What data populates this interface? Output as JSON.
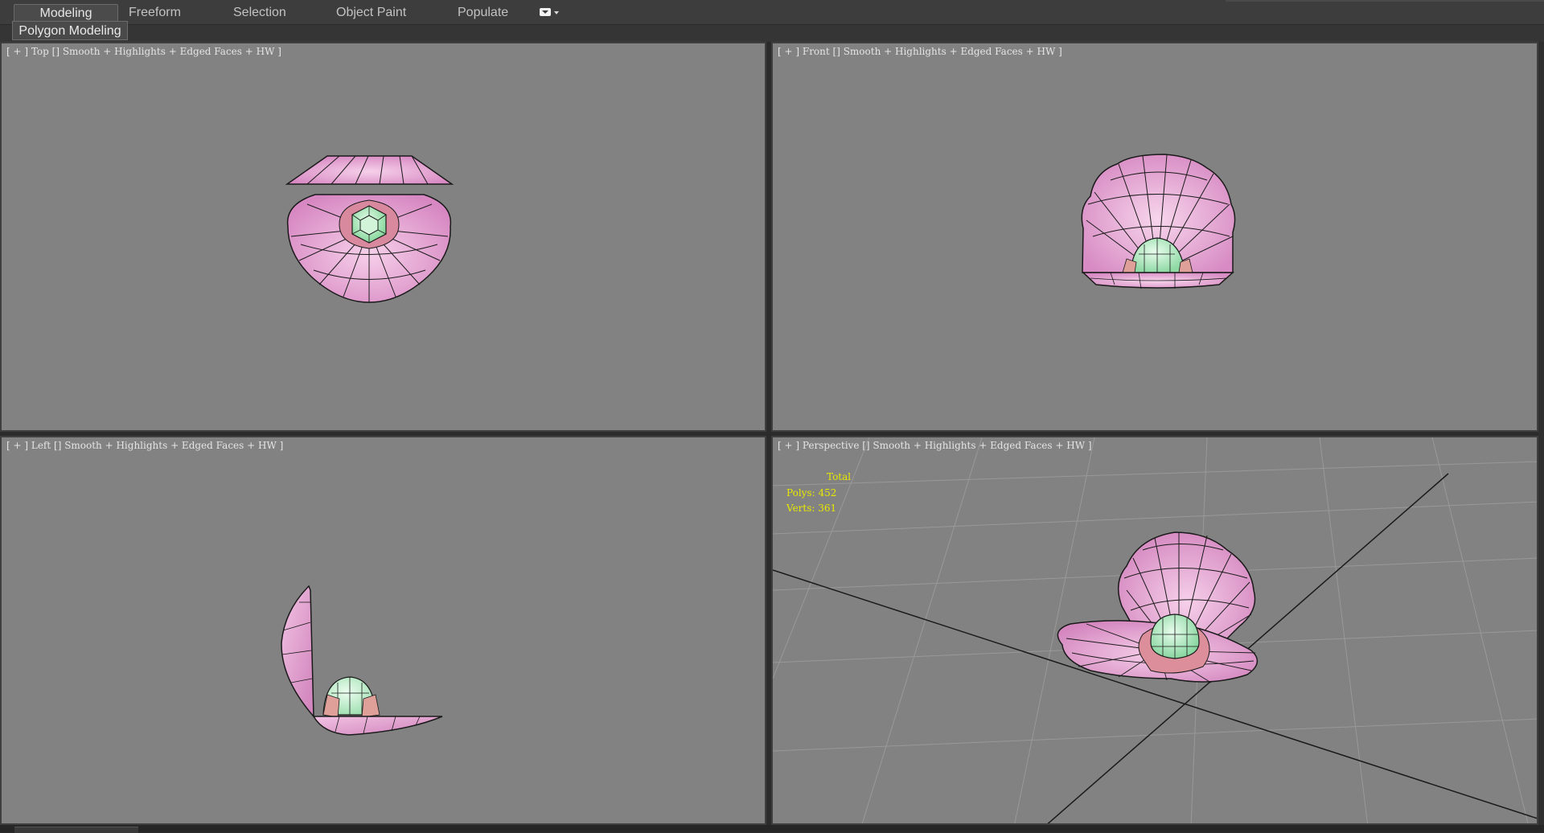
{
  "ribbon": {
    "tabs": [
      {
        "label": "Modeling",
        "active": true
      },
      {
        "label": "Freeform",
        "active": false
      },
      {
        "label": "Selection",
        "active": false
      },
      {
        "label": "Object Paint",
        "active": false
      },
      {
        "label": "Populate",
        "active": false
      }
    ],
    "dropdown_icon": "ribbon-options-icon",
    "panel_tab": "Polygon Modeling"
  },
  "viewports": {
    "top": {
      "label": "[ + ] Top [] Smooth + Highlights + Edged Faces + HW ]"
    },
    "front": {
      "label": "[ + ] Front [] Smooth + Highlights + Edged Faces + HW ]"
    },
    "left": {
      "label": "[ + ] Left [] Smooth + Highlights + Edged Faces + HW ]"
    },
    "perspective": {
      "label": "[ + ] Perspective [] Smooth + Highlights + Edged Faces + HW ]",
      "stats": {
        "title": "Total",
        "polys": "Polys: 452",
        "verts": "Verts: 361"
      }
    }
  },
  "colors": {
    "viewport_bg": "#828282",
    "shell": "#e7a7d4",
    "pearl": "#b7f2c5",
    "edges": "#1a1a1a",
    "stats_text": "#e8e800"
  }
}
